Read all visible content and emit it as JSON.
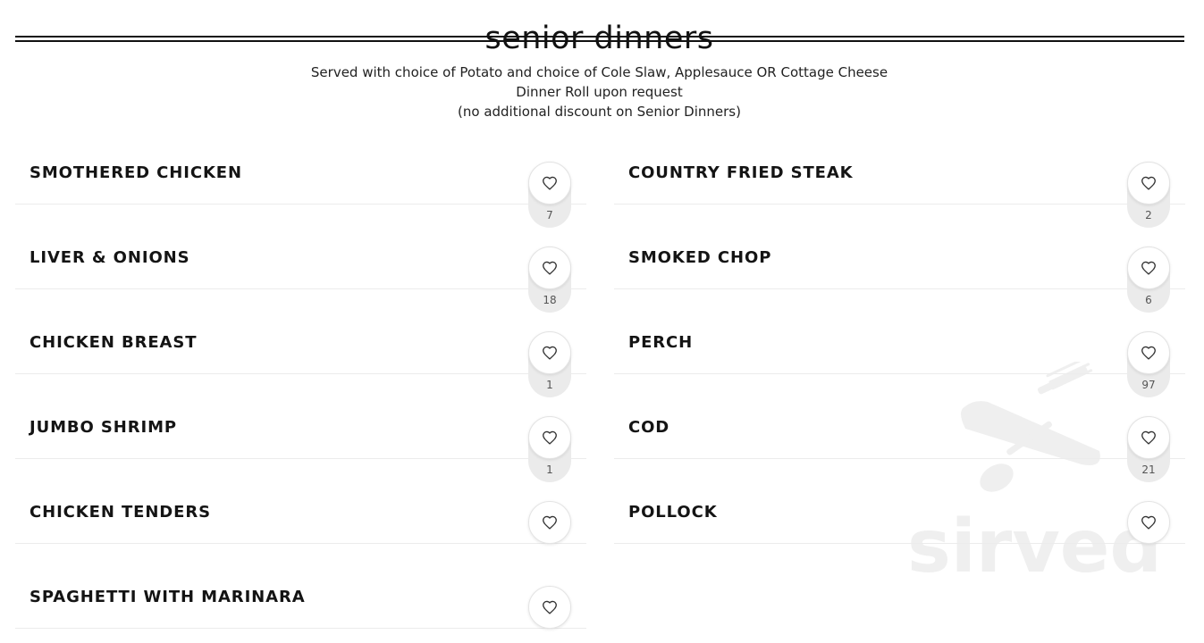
{
  "section": {
    "title": "senior dinners",
    "description_lines": [
      "Served with choice of Potato and choice of Cole Slaw, Applesauce OR Cottage Cheese",
      "Dinner Roll upon request",
      "(no additional discount on Senior Dinners)"
    ]
  },
  "items_left": [
    {
      "name": "SMOTHERED CHICKEN",
      "likes": "7"
    },
    {
      "name": "LIVER & ONIONS",
      "likes": "18"
    },
    {
      "name": "CHICKEN BREAST",
      "likes": "1"
    },
    {
      "name": "JUMBO SHRIMP",
      "likes": "1"
    },
    {
      "name": "CHICKEN TENDERS",
      "likes": ""
    },
    {
      "name": "SPAGHETTI WITH MARINARA",
      "likes": ""
    }
  ],
  "items_right": [
    {
      "name": "COUNTRY FRIED STEAK",
      "likes": "2"
    },
    {
      "name": "SMOKED CHOP",
      "likes": "6"
    },
    {
      "name": "PERCH",
      "likes": "97"
    },
    {
      "name": "COD",
      "likes": "21"
    },
    {
      "name": "POLLOCK",
      "likes": ""
    }
  ],
  "watermark": {
    "brand": "sirved",
    "icon": "utensils-knife-icon"
  },
  "colors": {
    "text": "#141414",
    "divider": "#ececec",
    "like_pill": "#ebebeb",
    "watermark": "#efefef"
  }
}
